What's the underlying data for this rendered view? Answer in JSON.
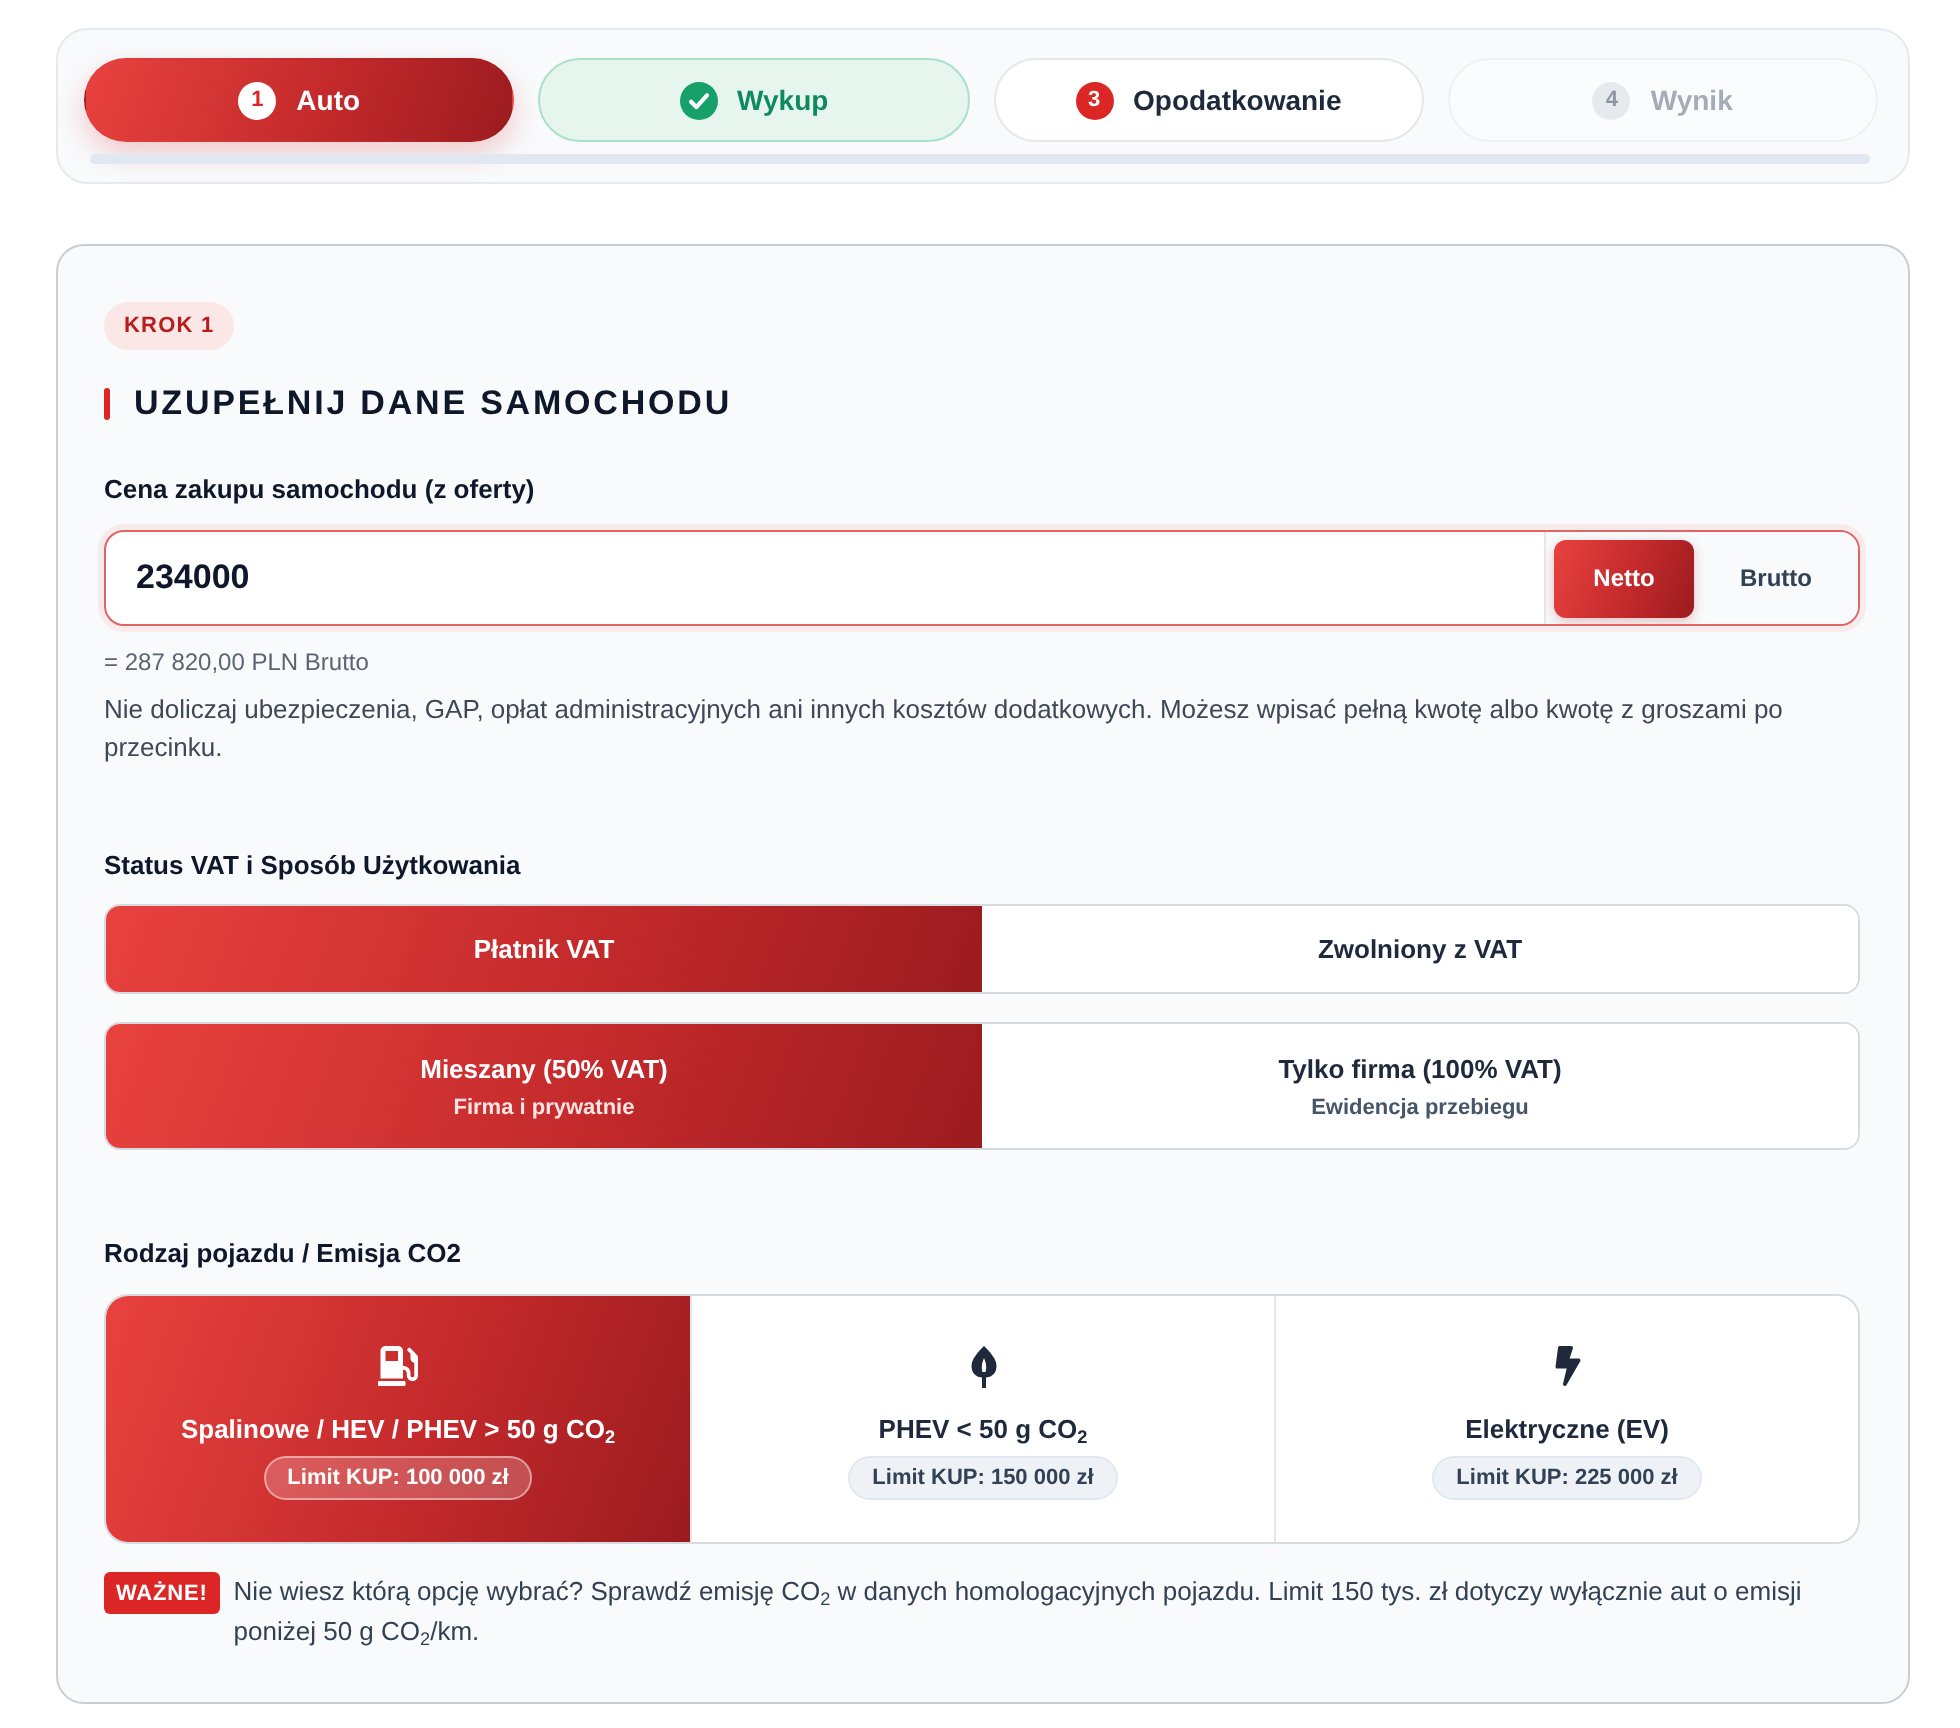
{
  "steps": [
    {
      "number": "1",
      "label": "Auto",
      "selected": true,
      "completed": false,
      "disabled": false
    },
    {
      "label": "Wykup",
      "selected": false,
      "completed": true,
      "disabled": false
    },
    {
      "number": "3",
      "label": "Opodatkowanie",
      "selected": false,
      "completed": false,
      "disabled": false
    },
    {
      "number": "4",
      "label": "Wynik",
      "selected": false,
      "completed": false,
      "disabled": true
    }
  ],
  "step_badge": "KROK 1",
  "heading": "UZUPEŁNIJ DANE SAMOCHODU",
  "price": {
    "label": "Cena zakupu samochodu (z oferty)",
    "value": "234000",
    "modes": [
      {
        "label": "Netto",
        "selected": true
      },
      {
        "label": "Brutto",
        "selected": false
      }
    ],
    "conversion": "= 287 820,00 PLN Brutto",
    "hint": "Nie doliczaj ubezpieczenia, GAP, opłat administracyjnych ani innych kosztów dodatkowych. Możesz wpisać pełną kwotę albo kwotę z groszami po przecinku."
  },
  "vat": {
    "label": "Status VAT i Sposób Użytkowania",
    "status_options": [
      {
        "label": "Płatnik VAT",
        "selected": true
      },
      {
        "label": "Zwolniony z VAT",
        "selected": false
      }
    ],
    "usage_options": [
      {
        "title": "Mieszany (50% VAT)",
        "subtitle": "Firma i prywatnie",
        "selected": true
      },
      {
        "title": "Tylko firma (100% VAT)",
        "subtitle": "Ewidencja przebiegu",
        "selected": false
      }
    ]
  },
  "vehicle": {
    "label": "Rodzaj pojazdu / Emisja CO2",
    "options": [
      {
        "kind": "fuel",
        "title": "Spalinowe / HEV / PHEV > 50 g CO$_{2}$",
        "limit": "Limit KUP: 100 000 zł",
        "selected": true
      },
      {
        "kind": "leaf",
        "title": "PHEV < 50 g CO$_{2}$",
        "limit": "Limit KUP: 150 000 zł",
        "selected": false
      },
      {
        "kind": "bolt",
        "title": "Elektryczne (EV)",
        "limit": "Limit KUP: 225 000 zł",
        "selected": false
      }
    ]
  },
  "notice": {
    "badge": "WAŻNE!",
    "text": "Nie wiesz którą opcję wybrać? Sprawdź emisję CO$_{2}$ w danych homologacyjnych pojazdu. Limit 150 tys. zł dotyczy wyłącznie aut o emisji poniżej 50 g CO$_{2}$/km."
  }
}
